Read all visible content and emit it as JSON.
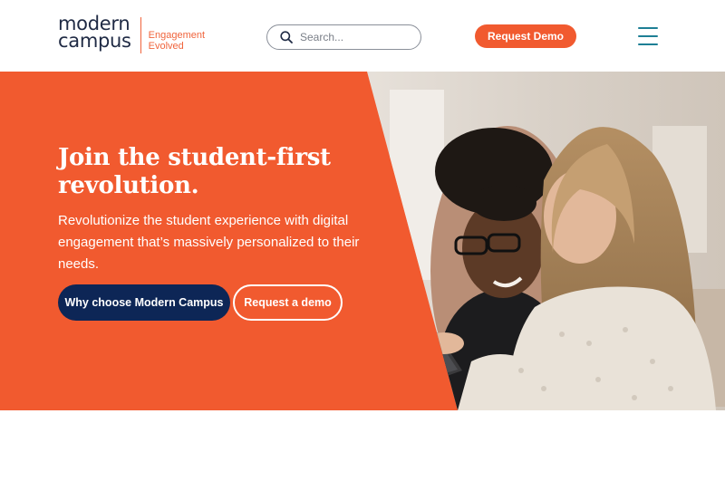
{
  "header": {
    "logo": {
      "line1": "modern",
      "line2": "campus",
      "tagline1": "Engagement",
      "tagline2": "Evolved"
    },
    "search": {
      "placeholder": "Search..."
    },
    "request_demo_label": "Request Demo"
  },
  "hero": {
    "title": "Join the student-first revolution.",
    "subtitle": "Revolutionize the student experience with digital engagement that’s massively personalized to their needs.",
    "primary_button": "Why choose Modern Campus",
    "secondary_button": "Request a demo"
  },
  "colors": {
    "brand_orange": "#f15a2f",
    "navy": "#0d2656",
    "teal_menu": "#1e7f95",
    "logo_text": "#1f2a44"
  },
  "icons": {
    "search": "search-icon",
    "menu": "hamburger-menu-icon"
  }
}
